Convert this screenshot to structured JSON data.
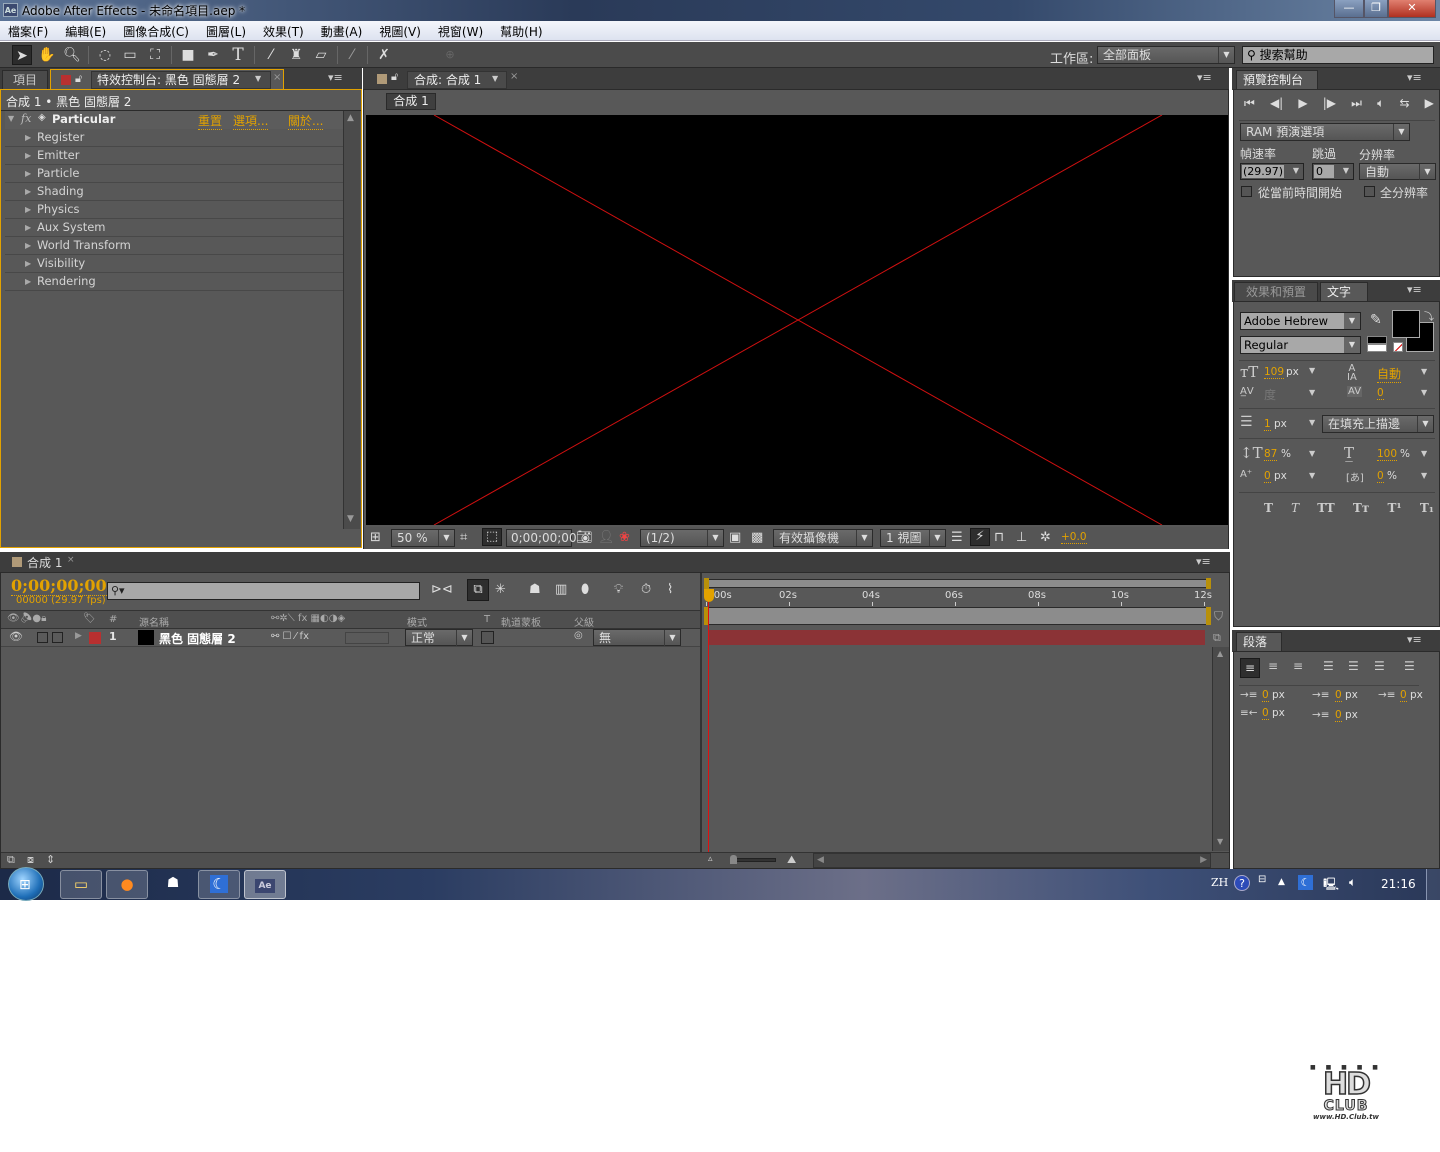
{
  "window": {
    "title": "Adobe After Effects - 未命名項目.aep *",
    "app_icon": "Ae",
    "buttons": {
      "minimize": "—",
      "restore": "❐",
      "close": "✕"
    }
  },
  "menubar": [
    "檔案(F)",
    "編輯(E)",
    "圖像合成(C)",
    "圖層(L)",
    "效果(T)",
    "動畫(A)",
    "視圖(V)",
    "視窗(W)",
    "幫助(H)"
  ],
  "toolbar": {
    "tools": [
      "selection-tool",
      "hand-tool",
      "zoom-tool",
      "rotation-tool",
      "camera-tool",
      "pan-behind-tool",
      "rectangle-tool",
      "pen-tool",
      "text-tool",
      "brush-tool",
      "clone-stamp-tool",
      "eraser-tool",
      "roto-brush-tool",
      "puppet-pin-tool"
    ],
    "workspace_label": "工作區:",
    "workspace_value": "全部面板",
    "search_placeholder": "搜索幫助"
  },
  "left_panel": {
    "tabs": [
      "項目",
      "特效控制台: 黑色 固態層 2"
    ],
    "breadcrumb": "合成 1 • 黑色 固態層 2",
    "effect": {
      "fx": "fx",
      "name": "Particular",
      "links": [
        "重置",
        "選項...",
        "關於..."
      ],
      "groups": [
        "Register",
        "Emitter",
        "Particle",
        "Shading",
        "Physics",
        "Aux System",
        "World Transform",
        "Visibility",
        "Rendering"
      ]
    }
  },
  "comp_panel": {
    "tab": "合成: 合成 1",
    "comp_button": "合成 1",
    "footer": {
      "zoom": "50 %",
      "timecode": "0;00;00;00",
      "resolution": "(1/2)",
      "camera": "有效攝像機",
      "views": "1 視圖",
      "exposure": "+0.0"
    }
  },
  "preview_panel": {
    "tab": "預覽控制台",
    "ram_preview": "RAM 預演選項",
    "labels": {
      "frame_rate": "幀速率",
      "skip": "跳過",
      "resolution": "分辨率"
    },
    "frame_rate": "(29.97)",
    "skip": "0",
    "resolution": "自動",
    "from_current": "從當前時間開始",
    "full_res": "全分辨率"
  },
  "character_panel": {
    "tabs": [
      "效果和預置",
      "文字"
    ],
    "font": "Adobe Hebrew",
    "style": "Regular",
    "size_value": "109",
    "size_unit": "px",
    "leading": "自動",
    "kerning": "度",
    "tracking": "0",
    "stroke_value": "1",
    "stroke_unit": "px",
    "stroke_mode": "在填充上描邊",
    "vscale_value": "87",
    "vscale_unit": "%",
    "hscale_value": "100",
    "hscale_unit": "%",
    "baseline_value": "0",
    "baseline_unit": "px",
    "tsume_value": "0",
    "tsume_unit": "%",
    "fill_color": "#000000",
    "stroke_color": "#000000",
    "style_buttons": [
      "T",
      "T",
      "TT",
      "Tт",
      "T¹",
      "T₁"
    ]
  },
  "paragraph_panel": {
    "tab": "段落",
    "indent_left": "0",
    "indent_first": "0",
    "indent_right": "0",
    "space_before": "0",
    "space_after": "0",
    "unit": "px"
  },
  "timeline": {
    "tab": "合成 1",
    "timecode": "0;00;00;00",
    "frame_info": "00000 (29.97 fps)",
    "search_placeholder": "",
    "columns": {
      "source_name": "源名稱",
      "mode": "模式",
      "t": "T",
      "trkmat": "軌道蒙板",
      "parent": "父級",
      "num": "#"
    },
    "ruler": [
      "0:00s",
      "02s",
      "04s",
      "06s",
      "08s",
      "10s",
      "12s"
    ],
    "layers": [
      {
        "num": "1",
        "name": "黑色 固態層 2",
        "label_color": "#b83030",
        "mode": "正常",
        "parent": "無",
        "bar_color": "#8b3336"
      }
    ]
  },
  "taskbar": {
    "apps": [
      "windows-explorer",
      "firefox",
      "app-3",
      "app-4",
      "after-effects"
    ],
    "lang": "ZH",
    "clock": "21:16"
  },
  "watermark": {
    "line1": "HD",
    "line2": "CLUB",
    "url": "www.HD.Club.tw"
  }
}
